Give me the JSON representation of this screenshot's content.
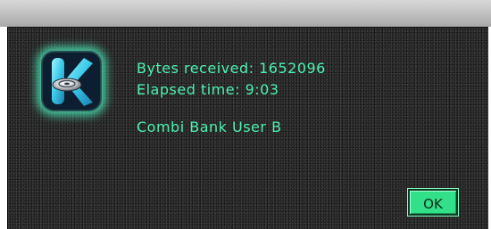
{
  "dialog": {
    "bytes_received_label": "Bytes received:",
    "bytes_received_value": "1652096",
    "elapsed_time_label": "Elapsed time:",
    "elapsed_time_value": "9:03",
    "bank_name": "Combi Bank User B",
    "ok_label": "OK"
  },
  "icon": {
    "name": "korg-k-disc-icon",
    "glow_color": "#4cf0b0"
  },
  "colors": {
    "text": "#4cf0b0",
    "button": "#33e08a",
    "background": "#2a2a2a"
  }
}
